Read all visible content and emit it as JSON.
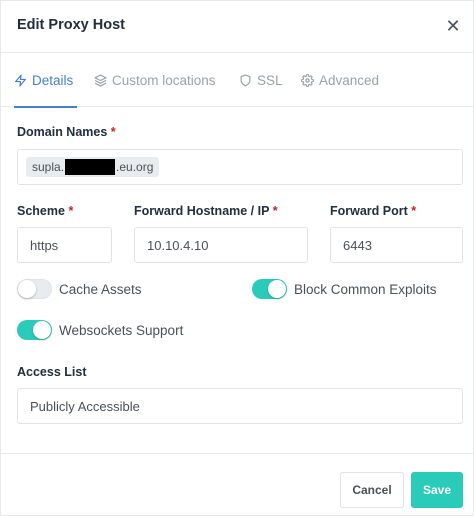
{
  "modal": {
    "title": "Edit Proxy Host"
  },
  "tabs": [
    {
      "label": "Details",
      "icon": "lightning-icon",
      "active": true
    },
    {
      "label": "Custom locations",
      "icon": "layers-icon",
      "active": false
    },
    {
      "label": "SSL",
      "icon": "shield-icon",
      "active": false
    },
    {
      "label": "Advanced",
      "icon": "gear-icon",
      "active": false
    }
  ],
  "form": {
    "domain_names": {
      "label": "Domain Names",
      "required_mark": "*",
      "chip_prefix": "supla.",
      "chip_suffix": ".eu.org"
    },
    "scheme": {
      "label": "Scheme",
      "required_mark": "*",
      "value": "https"
    },
    "forward_hostname": {
      "label": "Forward Hostname / IP",
      "required_mark": "*",
      "value": "10.10.4.10"
    },
    "forward_port": {
      "label": "Forward Port",
      "required_mark": "*",
      "value": "6443"
    },
    "toggles": {
      "cache_assets": {
        "label": "Cache Assets",
        "on": false
      },
      "block_exploits": {
        "label": "Block Common Exploits",
        "on": true
      },
      "websockets": {
        "label": "Websockets Support",
        "on": true
      }
    },
    "access_list": {
      "label": "Access List",
      "value": "Publicly Accessible"
    }
  },
  "footer": {
    "cancel_label": "Cancel",
    "save_label": "Save"
  },
  "colors": {
    "accent": "#467fcf",
    "toggle_on": "#2bcbba",
    "save_button": "#2bcbba",
    "required": "#cd201f"
  }
}
